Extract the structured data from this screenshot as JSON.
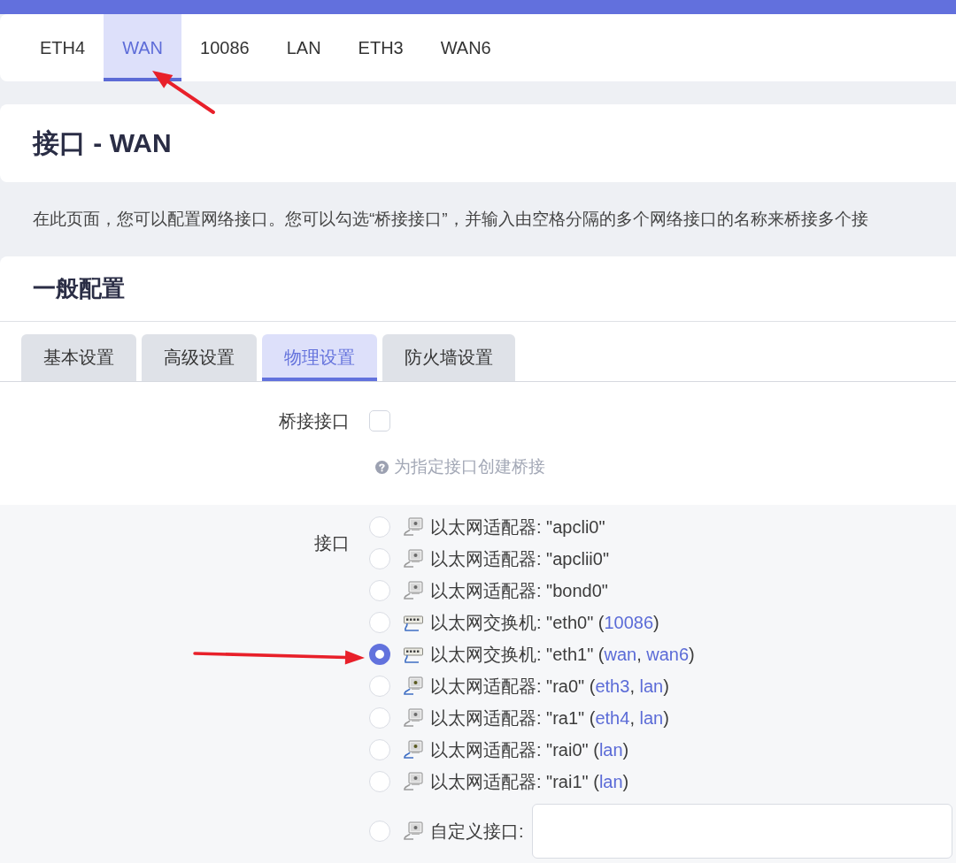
{
  "top_tabs": [
    {
      "label": "ETH4",
      "selected": false
    },
    {
      "label": "WAN",
      "selected": true
    },
    {
      "label": "10086",
      "selected": false
    },
    {
      "label": "LAN",
      "selected": false
    },
    {
      "label": "ETH3",
      "selected": false
    },
    {
      "label": "WAN6",
      "selected": false
    }
  ],
  "page_title": "接口 - WAN",
  "description": "在此页面，您可以配置网络接口。您可以勾选“桥接接口”，并输入由空格分隔的多个网络接口的名称来桥接多个接",
  "section": {
    "title": "一般配置",
    "tabs": [
      {
        "label": "基本设置",
        "selected": false
      },
      {
        "label": "高级设置",
        "selected": false
      },
      {
        "label": "物理设置",
        "selected": true
      },
      {
        "label": "防火墙设置",
        "selected": false
      }
    ]
  },
  "bridge_field": {
    "label": "桥接接口",
    "checked": false,
    "help": "为指定接口创建桥接"
  },
  "interface_field": {
    "label": "接口",
    "options": [
      {
        "kind": "adapter",
        "up": false,
        "selected": false,
        "segments": [
          {
            "text": "以太网适配器: \"apcli0\""
          }
        ]
      },
      {
        "kind": "adapter",
        "up": false,
        "selected": false,
        "segments": [
          {
            "text": "以太网适配器: \"apclii0\""
          }
        ]
      },
      {
        "kind": "adapter",
        "up": false,
        "selected": false,
        "segments": [
          {
            "text": "以太网适配器: \"bond0\""
          }
        ]
      },
      {
        "kind": "switch",
        "up": true,
        "selected": false,
        "segments": [
          {
            "text": "以太网交换机: \"eth0\" ("
          },
          {
            "link": "10086"
          },
          {
            "text": ")"
          }
        ]
      },
      {
        "kind": "switch",
        "up": true,
        "selected": true,
        "segments": [
          {
            "text": "以太网交换机: \"eth1\" ("
          },
          {
            "link": "wan"
          },
          {
            "text": ", "
          },
          {
            "link": "wan6"
          },
          {
            "text": ")"
          }
        ]
      },
      {
        "kind": "adapter",
        "up": true,
        "selected": false,
        "segments": [
          {
            "text": "以太网适配器: \"ra0\" ("
          },
          {
            "link": "eth3"
          },
          {
            "text": ", "
          },
          {
            "link": "lan"
          },
          {
            "text": ")"
          }
        ]
      },
      {
        "kind": "adapter",
        "up": false,
        "selected": false,
        "segments": [
          {
            "text": "以太网适配器: \"ra1\" ("
          },
          {
            "link": "eth4"
          },
          {
            "text": ", "
          },
          {
            "link": "lan"
          },
          {
            "text": ")"
          }
        ]
      },
      {
        "kind": "adapter",
        "up": true,
        "selected": false,
        "segments": [
          {
            "text": "以太网适配器: \"rai0\" ("
          },
          {
            "link": "lan"
          },
          {
            "text": ")"
          }
        ]
      },
      {
        "kind": "adapter",
        "up": false,
        "selected": false,
        "segments": [
          {
            "text": "以太网适配器: \"rai1\" ("
          },
          {
            "link": "lan"
          },
          {
            "text": ")"
          }
        ]
      },
      {
        "kind": "custom",
        "up": false,
        "selected": false,
        "segments": [
          {
            "text": "自定义接口:"
          }
        ]
      }
    ]
  }
}
